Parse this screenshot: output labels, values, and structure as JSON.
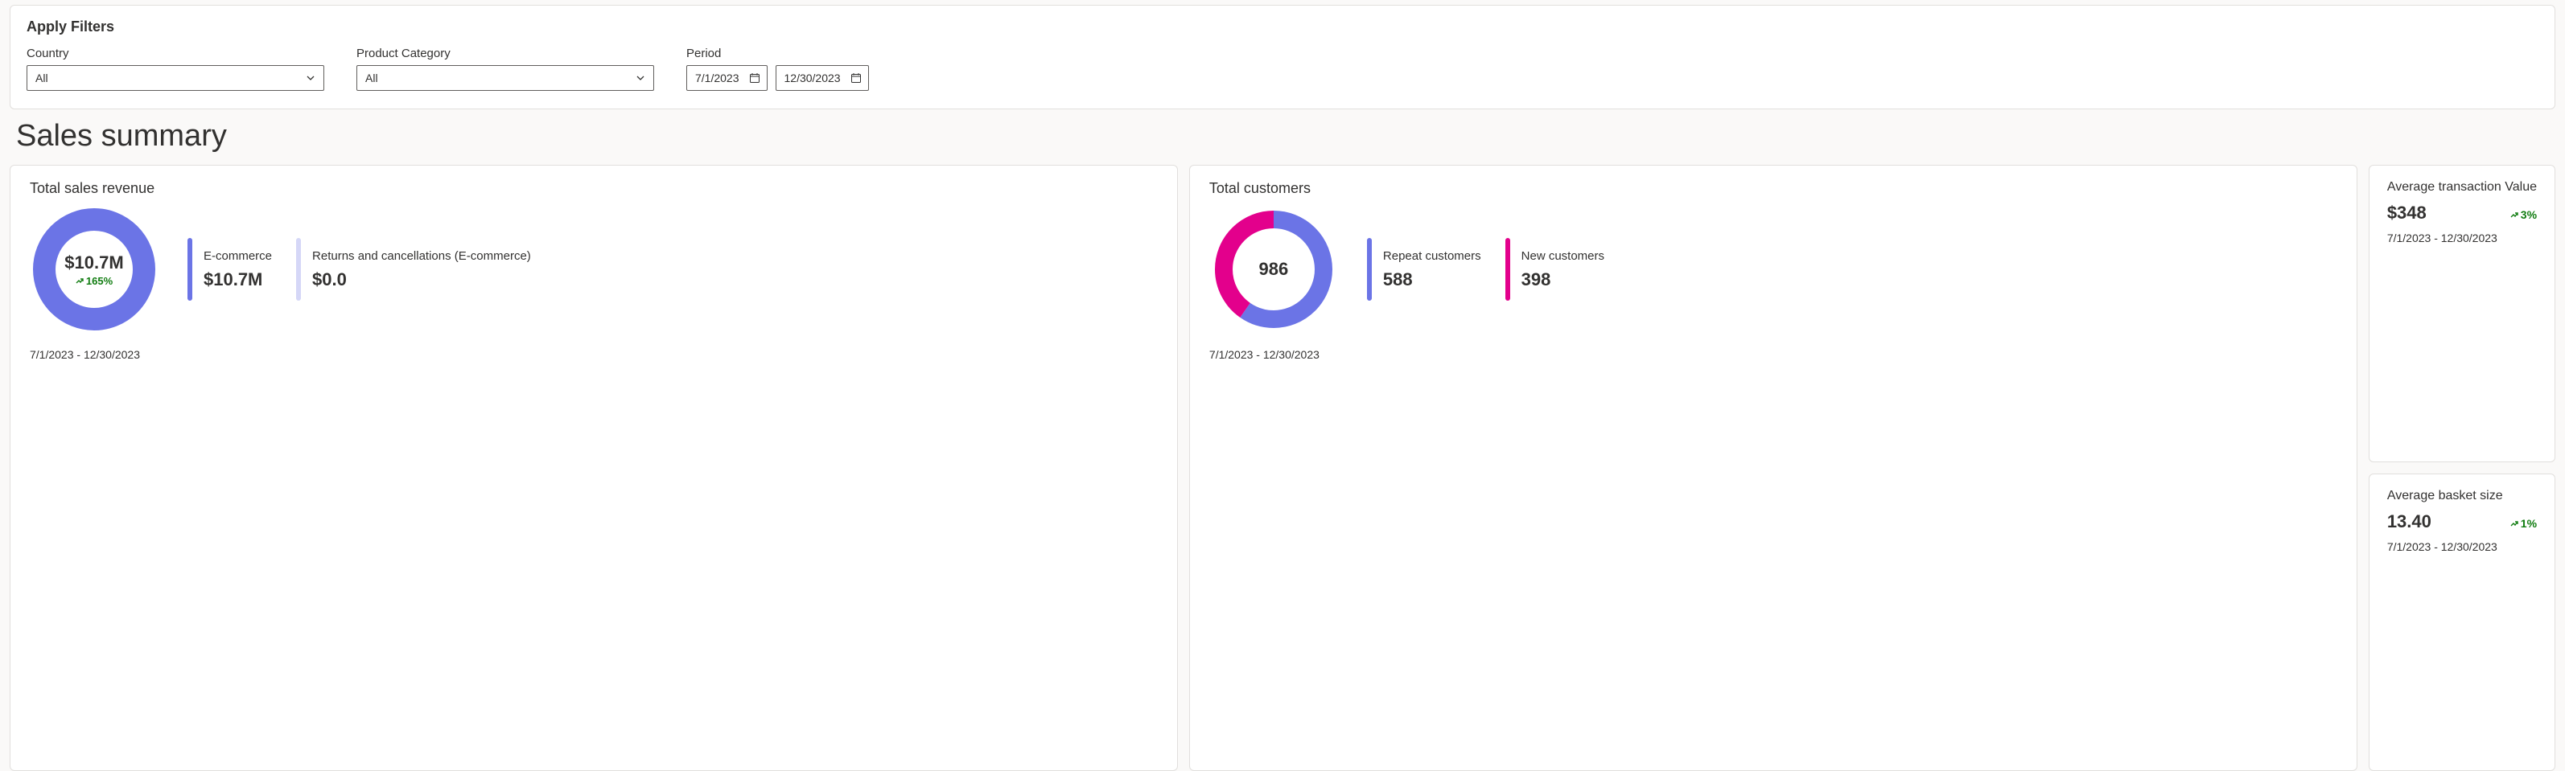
{
  "colors": {
    "indigo": "#6b74e6",
    "indigo_light": "#d5d7f7",
    "pink": "#e3008c",
    "green": "#107c10",
    "text": "#323130"
  },
  "filters": {
    "title": "Apply Filters",
    "country": {
      "label": "Country",
      "value": "All"
    },
    "product_category": {
      "label": "Product Category",
      "value": "All"
    },
    "period": {
      "label": "Period",
      "start": "7/1/2023",
      "end": "12/30/2023"
    }
  },
  "page_title": "Sales summary",
  "date_range_text": "7/1/2023 - 12/30/2023",
  "revenue_card": {
    "title": "Total sales revenue",
    "total": "$10.7M",
    "delta": "165%",
    "ecommerce_label": "E-commerce",
    "ecommerce_value": "$10.7M",
    "returns_label": "Returns and cancellations (E-commerce)",
    "returns_value": "$0.0"
  },
  "customers_card": {
    "title": "Total customers",
    "total": "986",
    "repeat_label": "Repeat customers",
    "repeat_value": "588",
    "new_label": "New customers",
    "new_value": "398"
  },
  "avg_transaction": {
    "title": "Average transaction Value",
    "value": "$348",
    "delta": "3%"
  },
  "avg_basket": {
    "title": "Average basket size",
    "value": "13.40",
    "delta": "1%"
  },
  "chart_data": [
    {
      "type": "pie",
      "title": "Total sales revenue",
      "series": [
        {
          "name": "E-commerce",
          "value": 10.7,
          "unit": "$M",
          "color": "#6b74e6"
        },
        {
          "name": "Returns and cancellations (E-commerce)",
          "value": 0.0,
          "unit": "$M",
          "color": "#d5d7f7"
        }
      ],
      "total_label": "$10.7M",
      "delta_pct": 165,
      "period": [
        "7/1/2023",
        "12/30/2023"
      ]
    },
    {
      "type": "pie",
      "title": "Total customers",
      "series": [
        {
          "name": "Repeat customers",
          "value": 588,
          "color": "#6b74e6"
        },
        {
          "name": "New customers",
          "value": 398,
          "color": "#e3008c"
        }
      ],
      "total_label": "986",
      "period": [
        "7/1/2023",
        "12/30/2023"
      ]
    }
  ]
}
